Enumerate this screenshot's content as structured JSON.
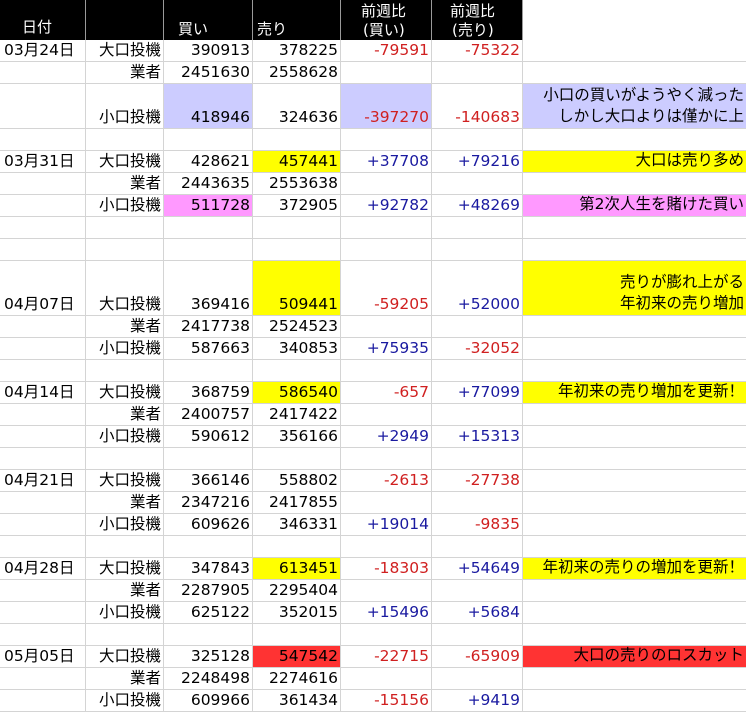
{
  "colors": {
    "yellow": "#ffff00",
    "pink": "#ff99ff",
    "lavender": "#ccccff",
    "red": "#ff3333",
    "pos": "#1a1aa0",
    "neg": "#d02020"
  },
  "headers": {
    "date": "日付",
    "buy": "買い",
    "sell": "売り",
    "diff_buy": [
      "前週比",
      "(買い)"
    ],
    "diff_sell": [
      "前週比",
      "(売り)"
    ]
  },
  "rows": [
    {
      "date": "03月24日",
      "type": "大口投機",
      "buy": "390913",
      "sell": "378225",
      "db": "-79591",
      "ds": "-75322"
    },
    {
      "type": "業者",
      "buy": "2451630",
      "sell": "2558628"
    },
    {
      "type": "小口投機",
      "buy": "418946",
      "sell": "324636",
      "db": "-397270",
      "ds": "-140683",
      "buy_bg": "lavender",
      "db_bg": "lavender",
      "note": [
        "小口の買いがようやく減った",
        "しかし大口よりは僅かに上"
      ],
      "note_bg": "lavender",
      "tall": true
    },
    {
      "blank": true
    },
    {
      "date": "03月31日",
      "type": "大口投機",
      "buy": "428621",
      "sell": "457441",
      "db": "+37708",
      "ds": "+79216",
      "sell_bg": "yellow",
      "note": [
        "大口は売り多め"
      ],
      "note_bg": "yellow"
    },
    {
      "type": "業者",
      "buy": "2443635",
      "sell": "2553638"
    },
    {
      "type": "小口投機",
      "buy": "511728",
      "sell": "372905",
      "db": "+92782",
      "ds": "+48269",
      "buy_bg": "pink",
      "note": [
        "第2次人生を賭けた買い"
      ],
      "note_bg": "pink"
    },
    {
      "blank": true
    },
    {
      "blank": true
    },
    {
      "date": "04月07日",
      "type": "大口投機",
      "buy": "369416",
      "sell": "509441",
      "db": "-59205",
      "ds": "+52000",
      "sell_bg": "yellow",
      "note": [
        "売りが膨れ上がる",
        "年初来の売り増加"
      ],
      "note_bg": "yellow",
      "tall2": true
    },
    {
      "type": "業者",
      "buy": "2417738",
      "sell": "2524523"
    },
    {
      "type": "小口投機",
      "buy": "587663",
      "sell": "340853",
      "db": "+75935",
      "ds": "-32052"
    },
    {
      "blank": true
    },
    {
      "date": "04月14日",
      "type": "大口投機",
      "buy": "368759",
      "sell": "586540",
      "db": "-657",
      "ds": "+77099",
      "sell_bg": "yellow",
      "note": [
        "年初来の売り増加を更新！"
      ],
      "note_bg": "yellow"
    },
    {
      "type": "業者",
      "buy": "2400757",
      "sell": "2417422"
    },
    {
      "type": "小口投機",
      "buy": "590612",
      "sell": "356166",
      "db": "+2949",
      "ds": "+15313"
    },
    {
      "blank": true
    },
    {
      "date": "04月21日",
      "type": "大口投機",
      "buy": "366146",
      "sell": "558802",
      "db": "-2613",
      "ds": "-27738"
    },
    {
      "type": "業者",
      "buy": "2347216",
      "sell": "2417855"
    },
    {
      "type": "小口投機",
      "buy": "609626",
      "sell": "346331",
      "db": "+19014",
      "ds": "-9835"
    },
    {
      "blank": true
    },
    {
      "date": "04月28日",
      "type": "大口投機",
      "buy": "347843",
      "sell": "613451",
      "db": "-18303",
      "ds": "+54649",
      "sell_bg": "yellow",
      "note": [
        "年初来の売りの増加を更新！"
      ],
      "note_bg": "yellow"
    },
    {
      "type": "業者",
      "buy": "2287905",
      "sell": "2295404"
    },
    {
      "type": "小口投機",
      "buy": "625122",
      "sell": "352015",
      "db": "+15496",
      "ds": "+5684"
    },
    {
      "blank": true
    },
    {
      "date": "05月05日",
      "type": "大口投機",
      "buy": "325128",
      "sell": "547542",
      "db": "-22715",
      "ds": "-65909",
      "sell_bg": "red",
      "note": [
        "大口の売りのロスカット"
      ],
      "note_bg": "red"
    },
    {
      "type": "業者",
      "buy": "2248498",
      "sell": "2274616"
    },
    {
      "type": "小口投機",
      "buy": "609966",
      "sell": "361434",
      "db": "-15156",
      "ds": "+9419"
    }
  ]
}
